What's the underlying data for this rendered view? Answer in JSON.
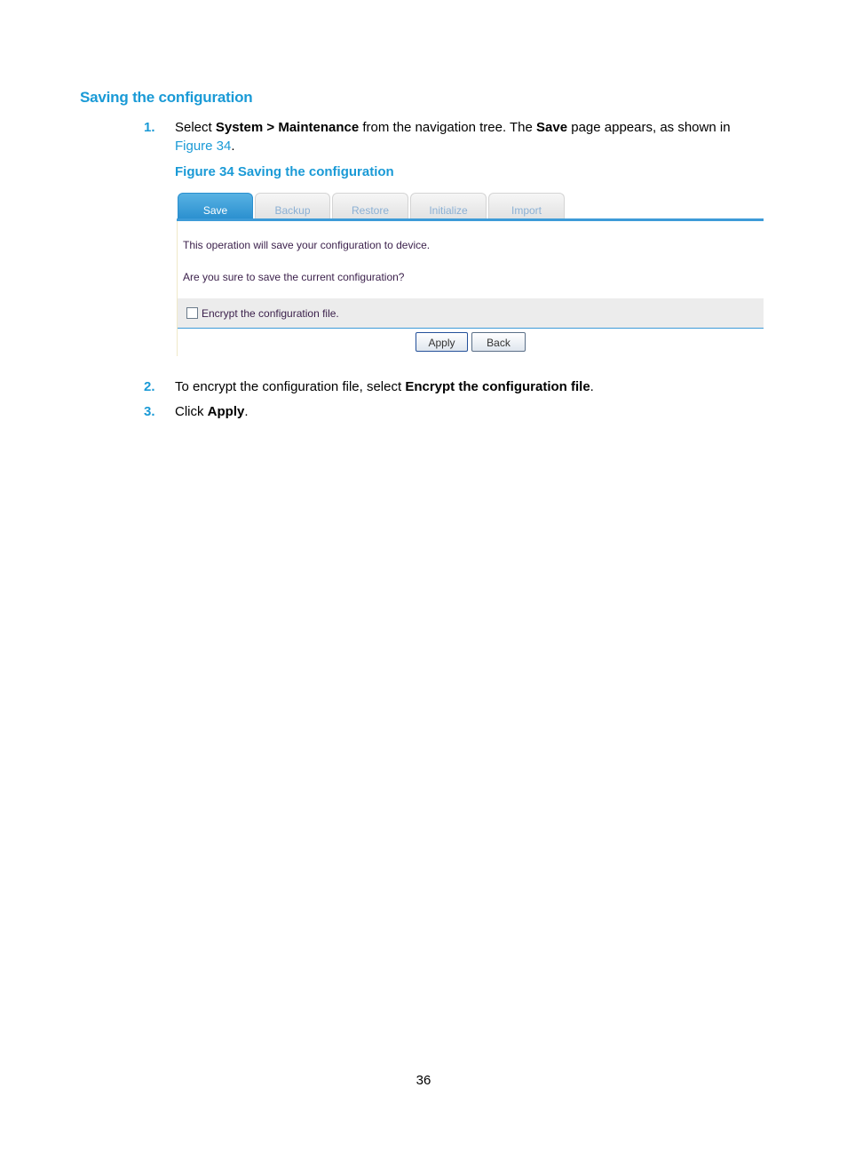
{
  "section": {
    "heading": "Saving the configuration"
  },
  "steps": [
    {
      "num": "1.",
      "parts": {
        "a": "Select ",
        "b1": "System > Maintenance",
        "c": " from the navigation tree. The ",
        "b2": "Save",
        "d": " page appears, as shown in ",
        "link": "Figure 34",
        "e": "."
      }
    },
    {
      "num": "2.",
      "parts": {
        "a": "To encrypt the configuration file, select ",
        "b1": "Encrypt the configuration file",
        "e": "."
      }
    },
    {
      "num": "3.",
      "parts": {
        "a": "Click ",
        "b1": "Apply",
        "e": "."
      }
    }
  ],
  "figure": {
    "caption": "Figure 34 Saving the configuration",
    "tabs": [
      {
        "label": "Save",
        "active": true
      },
      {
        "label": "Backup",
        "active": false
      },
      {
        "label": "Restore",
        "active": false
      },
      {
        "label": "Initialize",
        "active": false
      },
      {
        "label": "Import",
        "active": false
      }
    ],
    "message1": "This operation will save your configuration to device.",
    "message2": "Are you sure to save the current configuration?",
    "encrypt_label": "Encrypt the configuration file.",
    "encrypt_checked": false,
    "apply_label": "Apply",
    "back_label": "Back"
  },
  "colors": {
    "accent": "#1a9ad6",
    "tab_active": "#2a8fcf"
  },
  "page_number": "36"
}
